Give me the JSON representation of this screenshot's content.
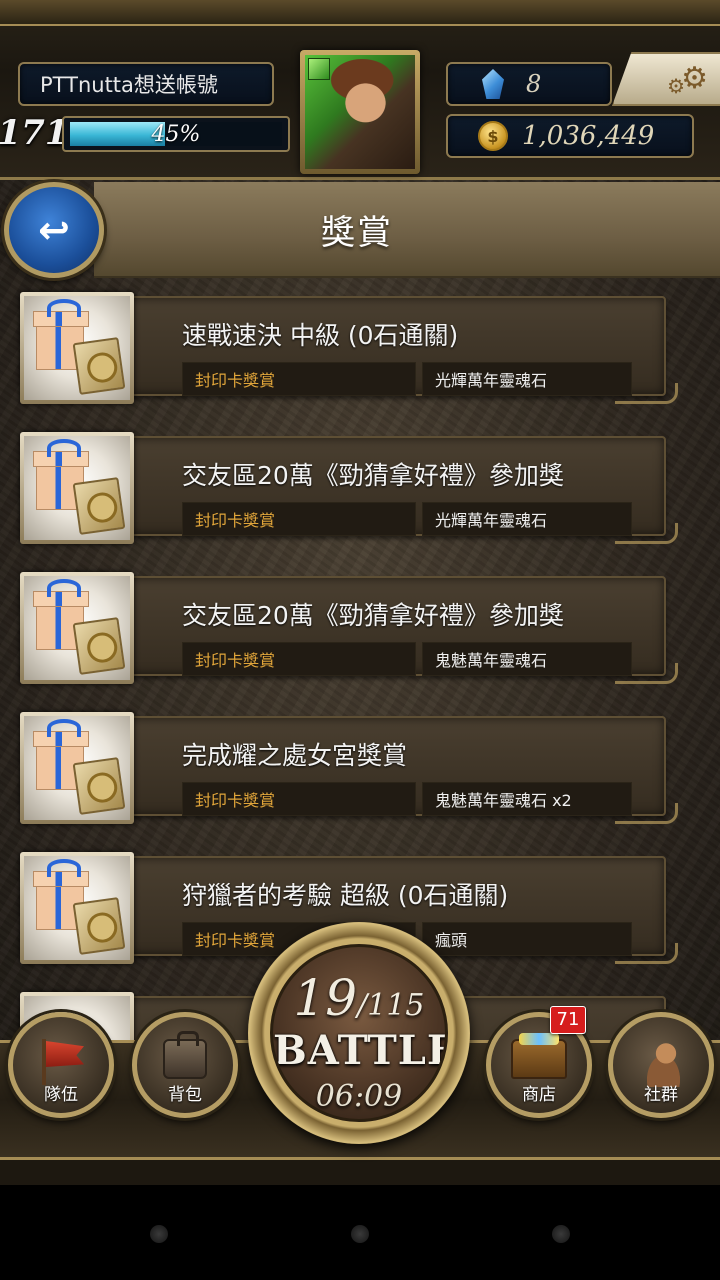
{
  "header": {
    "player_name": "PTTnutta想送帳號",
    "level": "171",
    "exp_percent_label": "45%",
    "exp_fraction": 0.45,
    "gems": "8",
    "coins": "1,036,449",
    "coin_symbol": "$"
  },
  "title_bar": {
    "title": "獎賞",
    "back_glyph": "↩"
  },
  "rewards": [
    {
      "name": "速戰速決 中級 (0石通關)",
      "type": "封印卡獎賞",
      "detail": "光輝萬年靈魂石"
    },
    {
      "name": "交友區20萬《勁猜拿好禮》參加獎",
      "type": "封印卡獎賞",
      "detail": "光輝萬年靈魂石"
    },
    {
      "name": "交友區20萬《勁猜拿好禮》參加獎",
      "type": "封印卡獎賞",
      "detail": "鬼魅萬年靈魂石"
    },
    {
      "name": "完成耀之處女宮獎賞",
      "type": "封印卡獎賞",
      "detail": "鬼魅萬年靈魂石 x2"
    },
    {
      "name": "狩獵者的考驗 超級 (0石通關)",
      "type": "封印卡獎賞",
      "detail": "瘋頭"
    }
  ],
  "bottom_nav": {
    "team_label": "隊伍",
    "bag_label": "背包",
    "shop_label": "商店",
    "shop_badge": "71",
    "social_label": "社群"
  },
  "battle": {
    "stamina_current": "19",
    "stamina_max": "/115",
    "label": "BATTLE",
    "timer": "06:09"
  },
  "icons": {
    "gem": "blue-crystal-icon",
    "coin": "gold-coin-icon",
    "settings": "gear-icon",
    "back": "back-arrow-icon",
    "reward": "gift-box-with-seal-card-icon",
    "team": "red-flag-icon",
    "bag": "backpack-icon",
    "shop": "treasure-chest-icon",
    "social": "people-silhouette-icon"
  },
  "colors": {
    "accent_gold": "#a68d55",
    "reward_type_text": "#e0a53a",
    "exp_bar": "#3ab7d6",
    "badge_red": "#d61d1d",
    "back_button_blue": "#1b4f9a"
  }
}
